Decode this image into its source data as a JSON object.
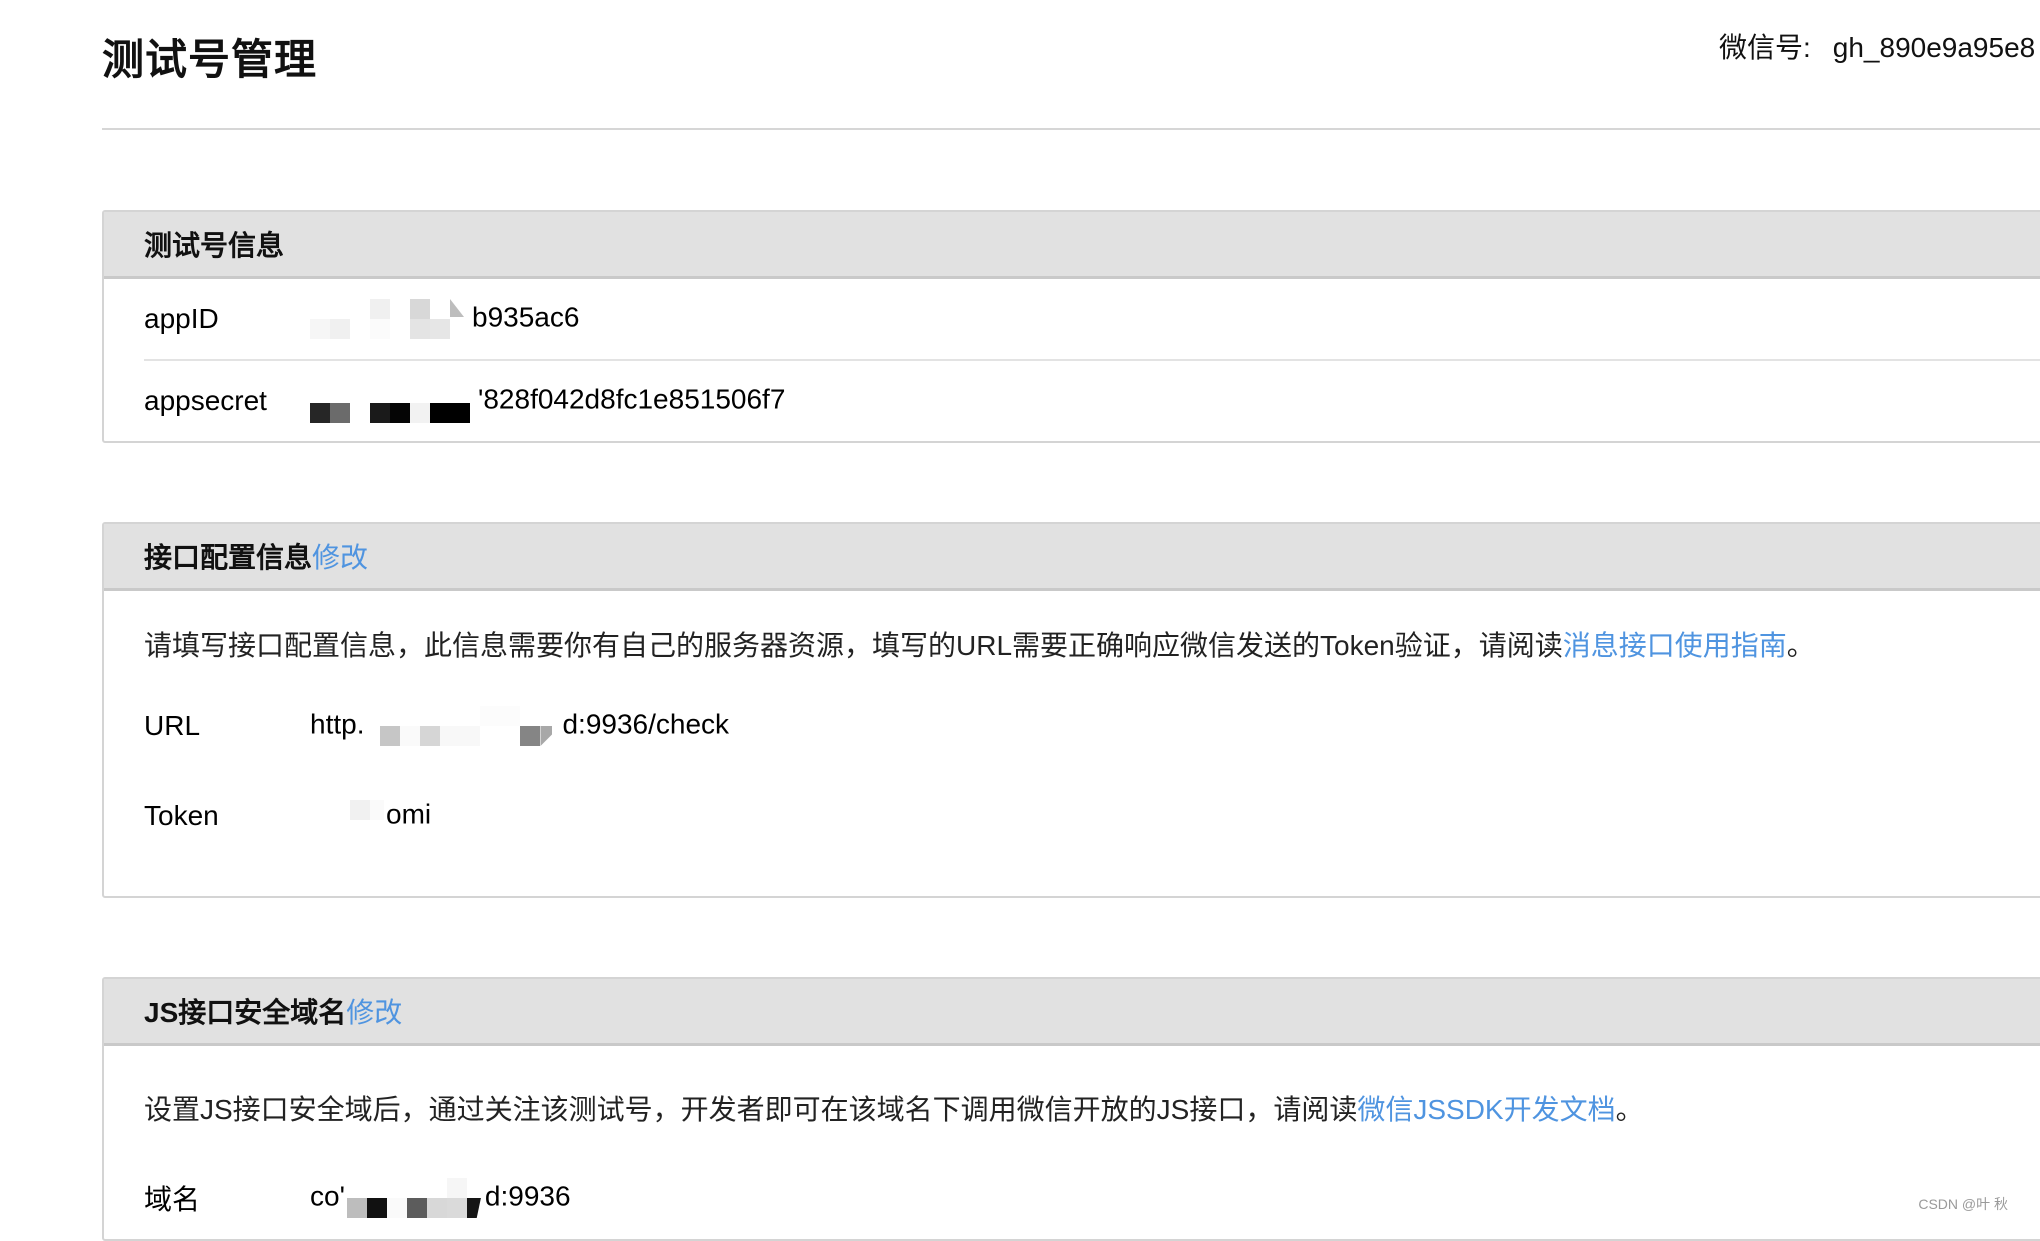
{
  "header": {
    "title": "测试号管理",
    "wechat_id_label": "微信号:",
    "wechat_id_value": "gh_890e9a95e8"
  },
  "sections": {
    "info": {
      "title": "测试号信息",
      "rows": [
        {
          "label": "appID",
          "value_visible": "b935ac6"
        },
        {
          "label": "appsecret",
          "value_visible": "'828f042d8fc1e851506f7"
        }
      ]
    },
    "interface": {
      "title": "接口配置信息",
      "edit_label": "修改",
      "description": "请填写接口配置信息，此信息需要你有自己的服务器资源，填写的URL需要正确响应微信发送的Token验证，请阅读",
      "description_link": "消息接口使用指南",
      "description_end": "。",
      "rows": [
        {
          "label": "URL",
          "value_prefix": "http.",
          "value_suffix": "d:9936/check"
        },
        {
          "label": "Token",
          "value_visible": "omi"
        }
      ]
    },
    "js_domain": {
      "title": "JS接口安全域名",
      "edit_label": "修改",
      "description": "设置JS接口安全域后，通过关注该测试号，开发者即可在该域名下调用微信开放的JS接口，请阅读",
      "description_link": "微信JSSDK开发文档",
      "description_end": "。",
      "rows": [
        {
          "label": "域名",
          "value_prefix": "co'",
          "value_suffix": "d:9936"
        }
      ]
    }
  },
  "watermark": "CSDN @叶 秋",
  "colors": {
    "link": "#4f94e0",
    "section_header_bg": "#e1e1e1",
    "border": "#d4d4d4"
  }
}
